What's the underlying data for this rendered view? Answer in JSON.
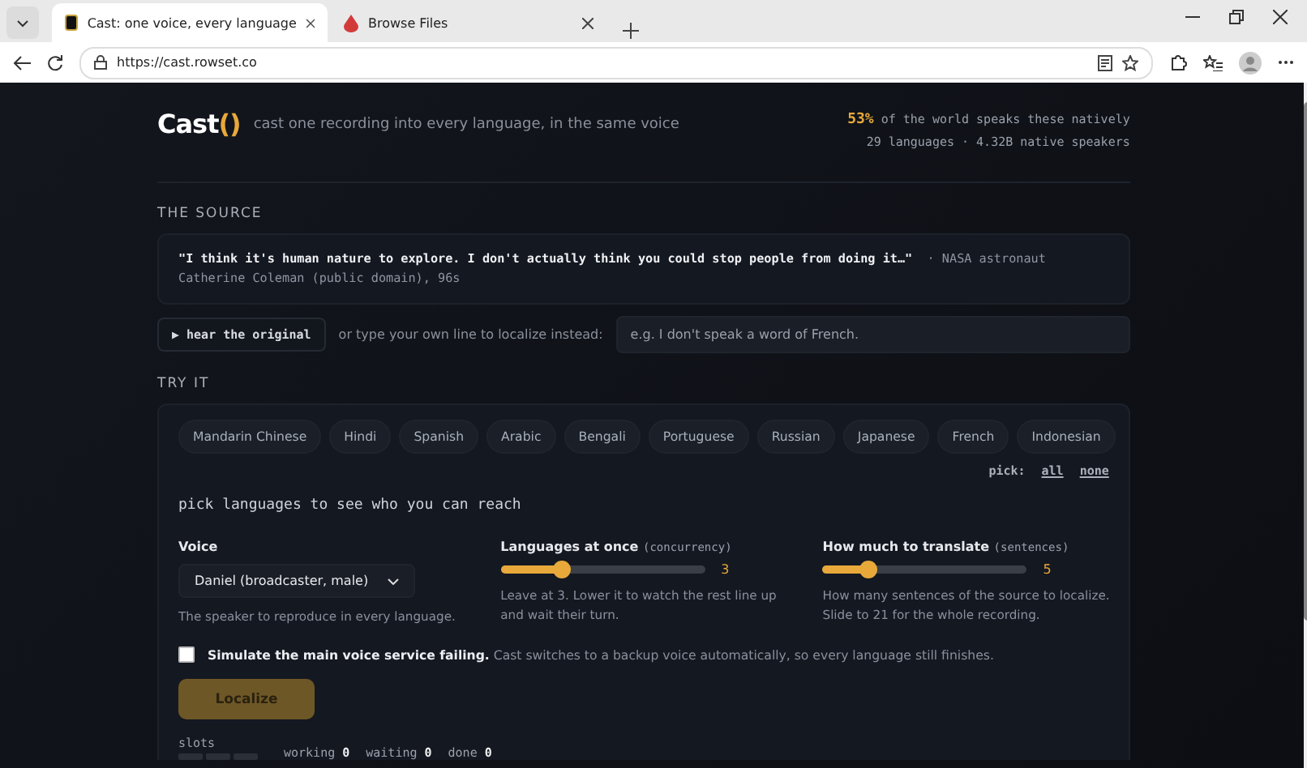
{
  "browser": {
    "tabs": [
      {
        "title": "Cast: one voice, every language",
        "selected": true
      },
      {
        "title": "Browse Files",
        "selected": false
      }
    ],
    "url": "https://cast.rowset.co"
  },
  "header": {
    "logo": "Cast",
    "logo_mark": "()",
    "tagline": "cast one recording into every language, in the same voice",
    "stat_percent": "53%",
    "stat_text": "of the world speaks these natively",
    "stat_sub": "29 languages · 4.32B native speakers"
  },
  "source": {
    "heading": "THE SOURCE",
    "quote": "\"I think it's human nature to explore. I don't actually think you could stop people from doing it…\"",
    "attribution": "· NASA astronaut Catherine Coleman (public domain), 96s",
    "play_button": "▶ hear the original",
    "or_text": "or type your own line to localize instead:",
    "line_placeholder": "e.g. I don't speak a word of French."
  },
  "try_it": {
    "heading": "TRY IT",
    "languages": [
      {
        "label": "Mandarin Chinese",
        "selected": false
      },
      {
        "label": "Hindi",
        "selected": false
      },
      {
        "label": "Spanish",
        "selected": false
      },
      {
        "label": "Arabic",
        "selected": false
      },
      {
        "label": "Bengali",
        "selected": false
      },
      {
        "label": "Portuguese",
        "selected": false
      },
      {
        "label": "Russian",
        "selected": false
      },
      {
        "label": "Japanese",
        "selected": false
      },
      {
        "label": "French",
        "selected": false
      },
      {
        "label": "Indonesian",
        "selected": false
      }
    ],
    "pick_label": "pick:",
    "pick_all": "all",
    "pick_none": "none",
    "reach_text": "pick languages to see who you can reach",
    "voice": {
      "label": "Voice",
      "value": "Daniel (broadcaster, male)",
      "help": "The speaker to reproduce in every language."
    },
    "sliders": [
      {
        "label": "Languages at once",
        "param": "(concurrency)",
        "level": 0.3,
        "reading": "3",
        "help": "Leave at 3. Lower it to watch the rest line up and wait their turn."
      },
      {
        "label": "How much to translate",
        "param": "(sentences)",
        "level": 0.22,
        "reading": "5",
        "help": "How many sentences of the source to localize. Slide to 21 for the whole recording."
      }
    ],
    "simulate": {
      "checked": false,
      "bold": "Simulate the main voice service failing.",
      "text": "Cast switches to a backup voice automatically, so every language still finishes."
    },
    "localize_button": "Localize",
    "slots_label": "slots",
    "slots": [
      {
        "busy": false
      },
      {
        "busy": false
      },
      {
        "busy": false
      }
    ],
    "counters": [
      {
        "label": "working",
        "value": "0"
      },
      {
        "label": "waiting",
        "value": "0"
      },
      {
        "label": "done",
        "value": "0"
      }
    ]
  }
}
